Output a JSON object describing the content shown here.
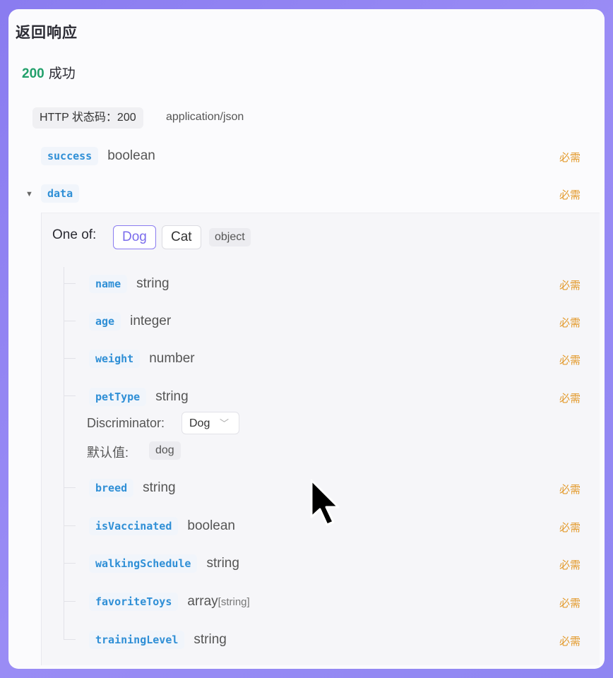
{
  "section_title": "返回响应",
  "status": {
    "code": "200",
    "text": "成功"
  },
  "http_badge": "HTTP 状态码：200",
  "content_type": "application/json",
  "required_label": "必需",
  "top_fields": [
    {
      "name": "success",
      "type": "boolean"
    },
    {
      "name": "data",
      "type": ""
    }
  ],
  "oneof": {
    "label": "One of:",
    "options": [
      "Dog",
      "Cat"
    ],
    "selected": "Dog",
    "type_tag": "object"
  },
  "fields": [
    {
      "name": "name",
      "type": "string"
    },
    {
      "name": "age",
      "type": "integer"
    },
    {
      "name": "weight",
      "type": "number"
    },
    {
      "name": "petType",
      "type": "string"
    },
    {
      "name": "breed",
      "type": "string"
    },
    {
      "name": "isVaccinated",
      "type": "boolean"
    },
    {
      "name": "walkingSchedule",
      "type": "string"
    },
    {
      "name": "favoriteToys",
      "type": "array",
      "type_sub": "[string]"
    },
    {
      "name": "trainingLevel",
      "type": "string"
    }
  ],
  "discriminator": {
    "label": "Discriminator:",
    "value": "Dog"
  },
  "default": {
    "label": "默认值:",
    "value": "dog"
  },
  "colors": {
    "accent": "#8a7cf0",
    "field_name": "#2f8fd6",
    "required": "#e39a2c",
    "success": "#22a06b"
  }
}
